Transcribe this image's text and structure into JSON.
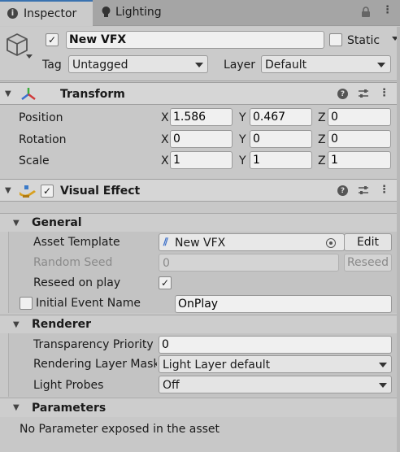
{
  "tabs": [
    {
      "label": "Inspector",
      "icon": "info-icon"
    },
    {
      "label": "Lighting",
      "icon": "lightbulb-icon"
    }
  ],
  "gameobject": {
    "name": "New VFX",
    "static_label": "Static",
    "tag_label": "Tag",
    "tag_value": "Untagged",
    "layer_label": "Layer",
    "layer_value": "Default"
  },
  "transform": {
    "title": "Transform",
    "rows": [
      {
        "label": "Position",
        "x": "1.586",
        "y": "0.467",
        "z": "0"
      },
      {
        "label": "Rotation",
        "x": "0",
        "y": "0",
        "z": "0"
      },
      {
        "label": "Scale",
        "x": "1",
        "y": "1",
        "z": "1"
      }
    ],
    "axis_labels": {
      "x": "X",
      "y": "Y",
      "z": "Z"
    }
  },
  "visual_effect": {
    "title": "Visual Effect",
    "general": {
      "title": "General",
      "asset_template_label": "Asset Template",
      "asset_template_value": "New VFX",
      "edit_label": "Edit",
      "random_seed_label": "Random Seed",
      "random_seed_value": "0",
      "reseed_label": "Reseed",
      "reseed_on_play_label": "Reseed on play",
      "initial_event_label": "Initial Event Name",
      "initial_event_value": "OnPlay"
    },
    "renderer": {
      "title": "Renderer",
      "transparency_label": "Transparency Priority",
      "transparency_value": "0",
      "rendering_layer_label": "Rendering Layer Mask",
      "rendering_layer_value": "Light Layer default",
      "light_probes_label": "Light Probes",
      "light_probes_value": "Off"
    },
    "parameters": {
      "title": "Parameters",
      "empty_message": "No Parameter exposed in the asset"
    }
  }
}
